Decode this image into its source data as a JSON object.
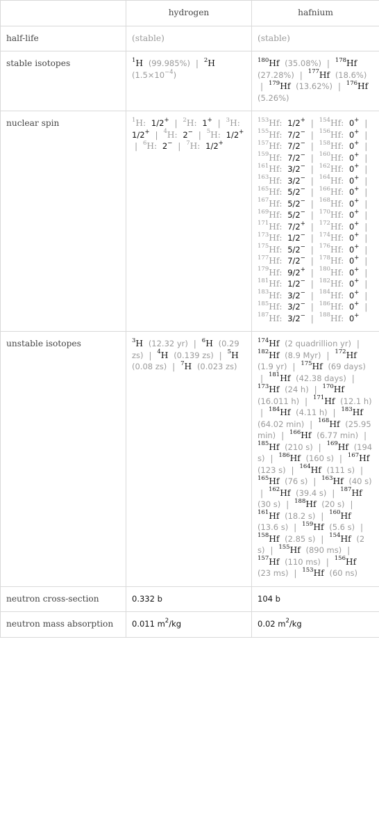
{
  "columns": [
    "",
    "hydrogen",
    "hafnium"
  ],
  "rows": {
    "half_life": {
      "label": "half-life",
      "hydrogen": "(stable)",
      "hafnium": "(stable)"
    },
    "stable_isotopes": {
      "label": "stable isotopes",
      "hydrogen": [
        {
          "mass": "1",
          "sym": "H",
          "value": "(99.985%)"
        },
        {
          "mass": "2",
          "sym": "H",
          "value": "(1.5×10",
          "exp": "−4",
          "tail": ")"
        }
      ],
      "hafnium": [
        {
          "mass": "180",
          "sym": "Hf",
          "value": "(35.08%)"
        },
        {
          "mass": "178",
          "sym": "Hf",
          "value": "(27.28%)"
        },
        {
          "mass": "177",
          "sym": "Hf",
          "value": "(18.6%)"
        },
        {
          "mass": "179",
          "sym": "Hf",
          "value": "(13.62%)"
        },
        {
          "mass": "176",
          "sym": "Hf",
          "value": "(5.26%)"
        }
      ]
    },
    "nuclear_spin": {
      "label": "nuclear spin",
      "hydrogen": [
        {
          "mass": "1",
          "sym": "H",
          "spin": "1/2",
          "parity": "+"
        },
        {
          "mass": "2",
          "sym": "H",
          "spin": "1",
          "parity": "+"
        },
        {
          "mass": "3",
          "sym": "H",
          "spin": "1/2",
          "parity": "+"
        },
        {
          "mass": "4",
          "sym": "H",
          "spin": "2",
          "parity": "−"
        },
        {
          "mass": "5",
          "sym": "H",
          "spin": "1/2",
          "parity": "+"
        },
        {
          "mass": "6",
          "sym": "H",
          "spin": "2",
          "parity": "−"
        },
        {
          "mass": "7",
          "sym": "H",
          "spin": "1/2",
          "parity": "+"
        }
      ],
      "hafnium": [
        {
          "mass": "153",
          "sym": "Hf",
          "spin": "1/2",
          "parity": "+"
        },
        {
          "mass": "154",
          "sym": "Hf",
          "spin": "0",
          "parity": "+"
        },
        {
          "mass": "155",
          "sym": "Hf",
          "spin": "7/2",
          "parity": "−"
        },
        {
          "mass": "156",
          "sym": "Hf",
          "spin": "0",
          "parity": "+"
        },
        {
          "mass": "157",
          "sym": "Hf",
          "spin": "7/2",
          "parity": "−"
        },
        {
          "mass": "158",
          "sym": "Hf",
          "spin": "0",
          "parity": "+"
        },
        {
          "mass": "159",
          "sym": "Hf",
          "spin": "7/2",
          "parity": "−"
        },
        {
          "mass": "160",
          "sym": "Hf",
          "spin": "0",
          "parity": "+"
        },
        {
          "mass": "161",
          "sym": "Hf",
          "spin": "3/2",
          "parity": "−"
        },
        {
          "mass": "162",
          "sym": "Hf",
          "spin": "0",
          "parity": "+"
        },
        {
          "mass": "163",
          "sym": "Hf",
          "spin": "3/2",
          "parity": "−"
        },
        {
          "mass": "164",
          "sym": "Hf",
          "spin": "0",
          "parity": "+"
        },
        {
          "mass": "165",
          "sym": "Hf",
          "spin": "5/2",
          "parity": "−"
        },
        {
          "mass": "166",
          "sym": "Hf",
          "spin": "0",
          "parity": "+"
        },
        {
          "mass": "167",
          "sym": "Hf",
          "spin": "5/2",
          "parity": "−"
        },
        {
          "mass": "168",
          "sym": "Hf",
          "spin": "0",
          "parity": "+"
        },
        {
          "mass": "169",
          "sym": "Hf",
          "spin": "5/2",
          "parity": "−"
        },
        {
          "mass": "170",
          "sym": "Hf",
          "spin": "0",
          "parity": "+"
        },
        {
          "mass": "171",
          "sym": "Hf",
          "spin": "7/2",
          "parity": "+"
        },
        {
          "mass": "172",
          "sym": "Hf",
          "spin": "0",
          "parity": "+"
        },
        {
          "mass": "173",
          "sym": "Hf",
          "spin": "1/2",
          "parity": "−"
        },
        {
          "mass": "174",
          "sym": "Hf",
          "spin": "0",
          "parity": "+"
        },
        {
          "mass": "175",
          "sym": "Hf",
          "spin": "5/2",
          "parity": "−"
        },
        {
          "mass": "176",
          "sym": "Hf",
          "spin": "0",
          "parity": "+"
        },
        {
          "mass": "177",
          "sym": "Hf",
          "spin": "7/2",
          "parity": "−"
        },
        {
          "mass": "178",
          "sym": "Hf",
          "spin": "0",
          "parity": "+"
        },
        {
          "mass": "179",
          "sym": "Hf",
          "spin": "9/2",
          "parity": "+"
        },
        {
          "mass": "180",
          "sym": "Hf",
          "spin": "0",
          "parity": "+"
        },
        {
          "mass": "181",
          "sym": "Hf",
          "spin": "1/2",
          "parity": "−"
        },
        {
          "mass": "182",
          "sym": "Hf",
          "spin": "0",
          "parity": "+"
        },
        {
          "mass": "183",
          "sym": "Hf",
          "spin": "3/2",
          "parity": "−"
        },
        {
          "mass": "184",
          "sym": "Hf",
          "spin": "0",
          "parity": "+"
        },
        {
          "mass": "185",
          "sym": "Hf",
          "spin": "3/2",
          "parity": "−"
        },
        {
          "mass": "186",
          "sym": "Hf",
          "spin": "0",
          "parity": "+"
        },
        {
          "mass": "187",
          "sym": "Hf",
          "spin": "3/2",
          "parity": "−"
        },
        {
          "mass": "188",
          "sym": "Hf",
          "spin": "0",
          "parity": "+"
        }
      ]
    },
    "unstable_isotopes": {
      "label": "unstable isotopes",
      "hydrogen": [
        {
          "mass": "3",
          "sym": "H",
          "value": "(12.32 yr)"
        },
        {
          "mass": "6",
          "sym": "H",
          "value": "(0.29 zs)"
        },
        {
          "mass": "4",
          "sym": "H",
          "value": "(0.139 zs)"
        },
        {
          "mass": "5",
          "sym": "H",
          "value": "(0.08 zs)"
        },
        {
          "mass": "7",
          "sym": "H",
          "value": "(0.023 zs)"
        }
      ],
      "hafnium": [
        {
          "mass": "174",
          "sym": "Hf",
          "value": "(2 quadrillion yr)"
        },
        {
          "mass": "182",
          "sym": "Hf",
          "value": "(8.9 Myr)"
        },
        {
          "mass": "172",
          "sym": "Hf",
          "value": "(1.9 yr)"
        },
        {
          "mass": "175",
          "sym": "Hf",
          "value": "(69 days)"
        },
        {
          "mass": "181",
          "sym": "Hf",
          "value": "(42.38 days)"
        },
        {
          "mass": "173",
          "sym": "Hf",
          "value": "(24 h)"
        },
        {
          "mass": "170",
          "sym": "Hf",
          "value": "(16.011 h)"
        },
        {
          "mass": "171",
          "sym": "Hf",
          "value": "(12.1 h)"
        },
        {
          "mass": "184",
          "sym": "Hf",
          "value": "(4.11 h)"
        },
        {
          "mass": "183",
          "sym": "Hf",
          "value": "(64.02 min)"
        },
        {
          "mass": "168",
          "sym": "Hf",
          "value": "(25.95 min)"
        },
        {
          "mass": "166",
          "sym": "Hf",
          "value": "(6.77 min)"
        },
        {
          "mass": "185",
          "sym": "Hf",
          "value": "(210 s)"
        },
        {
          "mass": "169",
          "sym": "Hf",
          "value": "(194 s)"
        },
        {
          "mass": "186",
          "sym": "Hf",
          "value": "(160 s)"
        },
        {
          "mass": "167",
          "sym": "Hf",
          "value": "(123 s)"
        },
        {
          "mass": "164",
          "sym": "Hf",
          "value": "(111 s)"
        },
        {
          "mass": "165",
          "sym": "Hf",
          "value": "(76 s)"
        },
        {
          "mass": "163",
          "sym": "Hf",
          "value": "(40 s)"
        },
        {
          "mass": "162",
          "sym": "Hf",
          "value": "(39.4 s)"
        },
        {
          "mass": "187",
          "sym": "Hf",
          "value": "(30 s)"
        },
        {
          "mass": "188",
          "sym": "Hf",
          "value": "(20 s)"
        },
        {
          "mass": "161",
          "sym": "Hf",
          "value": "(18.2 s)"
        },
        {
          "mass": "160",
          "sym": "Hf",
          "value": "(13.6 s)"
        },
        {
          "mass": "159",
          "sym": "Hf",
          "value": "(5.6 s)"
        },
        {
          "mass": "158",
          "sym": "Hf",
          "value": "(2.85 s)"
        },
        {
          "mass": "154",
          "sym": "Hf",
          "value": "(2 s)"
        },
        {
          "mass": "155",
          "sym": "Hf",
          "value": "(890 ms)"
        },
        {
          "mass": "157",
          "sym": "Hf",
          "value": "(110 ms)"
        },
        {
          "mass": "156",
          "sym": "Hf",
          "value": "(23 ms)"
        },
        {
          "mass": "153",
          "sym": "Hf",
          "value": "(60 ns)"
        }
      ]
    },
    "neutron_cross_section": {
      "label": "neutron cross-section",
      "hydrogen": "0.332 b",
      "hafnium": "104 b"
    },
    "neutron_mass_absorption": {
      "label": "neutron mass absorption",
      "hydrogen": {
        "num": "0.011 m",
        "exp": "2",
        "unit": "/kg"
      },
      "hafnium": {
        "num": "0.02 m",
        "exp": "2",
        "unit": "/kg"
      }
    }
  },
  "separator": "|"
}
